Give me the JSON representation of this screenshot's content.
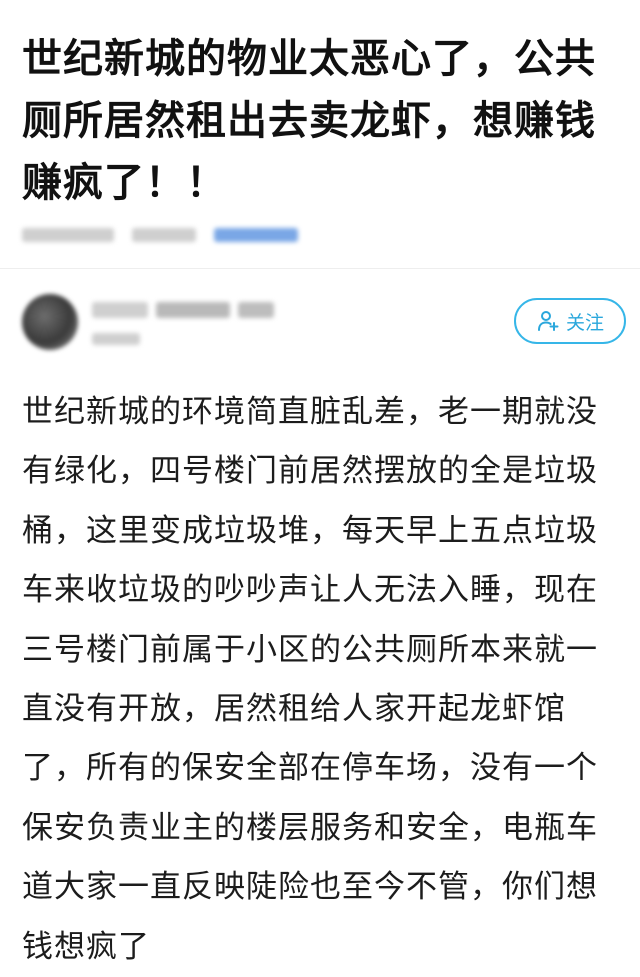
{
  "post": {
    "title": "世纪新城的物业太恶心了，公共厕所居然租出去卖龙虾，想赚钱赚疯了！！",
    "body": "世纪新城的环境简直脏乱差，老一期就没有绿化，四号楼门前居然摆放的全是垃圾桶，这里变成垃圾堆，每天早上五点垃圾车来收垃圾的吵吵声让人无法入睡，现在三号楼门前属于小区的公共厕所本来就一直没有开放，居然租给人家开起龙虾馆了，所有的保安全部在停车场，没有一个保安负责业主的楼层服务和安全，电瓶车道大家一直反映陡险也至今不管，你们想钱想疯了"
  },
  "author": {
    "follow_label": "关注"
  },
  "colors": {
    "accent": "#36b6e8",
    "text": "#1c1c1c",
    "blurred_text": "#cfcfcf",
    "blurred_link": "#7aa7e6"
  },
  "icons": {
    "follow_icon": "person-add-icon",
    "avatar": "avatar"
  }
}
